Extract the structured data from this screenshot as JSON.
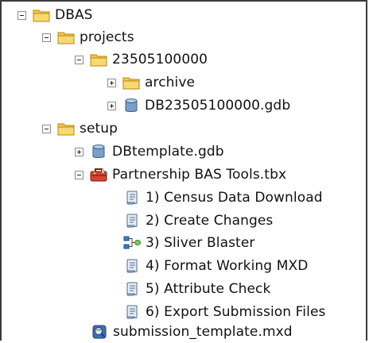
{
  "tree": {
    "items": [
      {
        "label": "DBAS",
        "icon": "folder-icon",
        "expander": "minus"
      },
      {
        "label": "projects",
        "icon": "folder-icon",
        "expander": "minus"
      },
      {
        "label": "23505100000",
        "icon": "folder-icon",
        "expander": "minus"
      },
      {
        "label": "archive",
        "icon": "folder-icon",
        "expander": "plus"
      },
      {
        "label": "DB23505100000.gdb",
        "icon": "geodatabase-icon",
        "expander": "plus"
      },
      {
        "label": "setup",
        "icon": "folder-icon",
        "expander": "minus"
      },
      {
        "label": "DBtemplate.gdb",
        "icon": "geodatabase-icon",
        "expander": "plus"
      },
      {
        "label": "Partnership BAS Tools.tbx",
        "icon": "toolbox-icon",
        "expander": "minus"
      },
      {
        "label": "1) Census Data Download",
        "icon": "script-icon"
      },
      {
        "label": "2) Create Changes",
        "icon": "script-icon"
      },
      {
        "label": "3) Sliver Blaster",
        "icon": "model-icon"
      },
      {
        "label": "4) Format Working MXD",
        "icon": "script-icon"
      },
      {
        "label": "5) Attribute Check",
        "icon": "script-icon"
      },
      {
        "label": "6) Export Submission Files",
        "icon": "script-icon"
      },
      {
        "label": "submission_template.mxd",
        "icon": "map-document-icon"
      }
    ]
  },
  "colors": {
    "folder": "#f2c94c",
    "folder_edge": "#b8860b",
    "frame": "#3a3a3a"
  }
}
